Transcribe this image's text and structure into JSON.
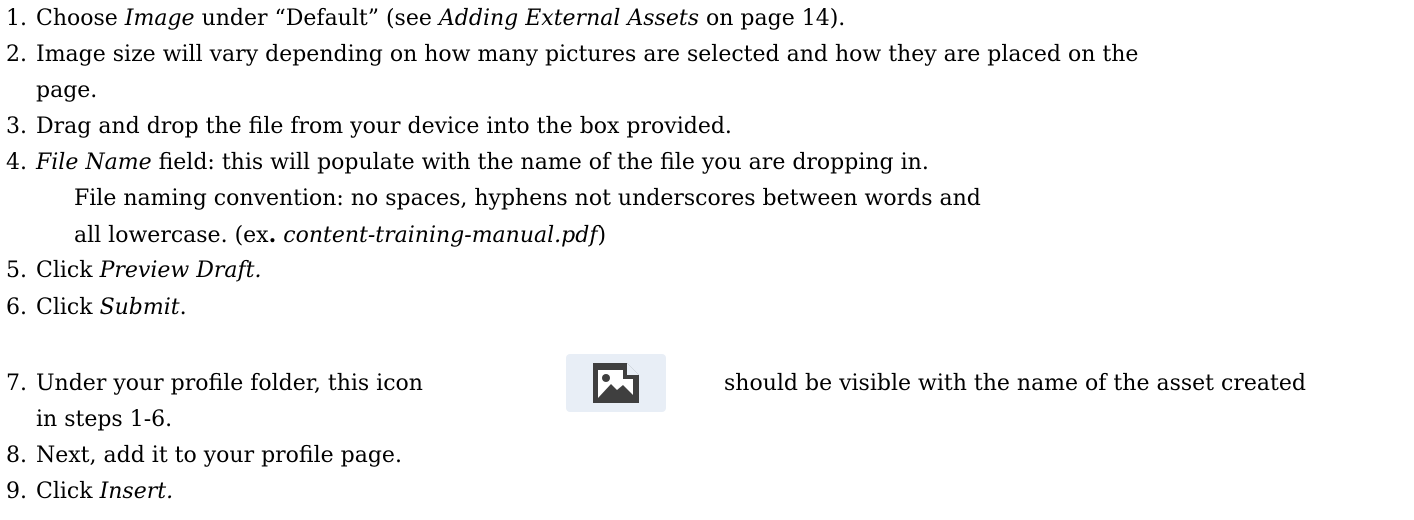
{
  "steps": [
    {
      "num": "1.",
      "parts": [
        {
          "t": "Choose ",
          "s": ""
        },
        {
          "t": "Image",
          "s": "i"
        },
        {
          "t": " under “Default” (see ",
          "s": ""
        },
        {
          "t": "Adding External Assets",
          "s": "i"
        },
        {
          "t": " on page 14).",
          "s": ""
        }
      ]
    },
    {
      "num": "2.",
      "parts": [
        {
          "t": "Image size will vary depending on how many pictures are selected and how they are placed on the",
          "s": ""
        }
      ]
    },
    {
      "cont": "page."
    },
    {
      "num": "3.",
      "parts": [
        {
          "t": "Drag and drop the file from your device into the box provided.",
          "s": ""
        }
      ]
    },
    {
      "num": "4.",
      "parts": [
        {
          "t": "File Name",
          "s": "i"
        },
        {
          "t": " field: this will populate with the name of the file you are dropping in.",
          "s": ""
        }
      ]
    },
    {
      "sub": "File naming convention: no spaces, hyphens not underscores between words and"
    },
    {
      "sub_parts": [
        {
          "t": "all lowercase. (ex",
          "s": ""
        },
        {
          "t": ".",
          "s": "b"
        },
        {
          "t": " ",
          "s": ""
        },
        {
          "t": "content-training-manual.pdf",
          "s": "i"
        },
        {
          "t": ")",
          "s": ""
        }
      ]
    },
    {
      "num": "5.",
      "parts": [
        {
          "t": "Click ",
          "s": ""
        },
        {
          "t": "Preview Draft.",
          "s": "i"
        }
      ]
    },
    {
      "num": "6.",
      "parts": [
        {
          "t": "Click ",
          "s": ""
        },
        {
          "t": "Submit",
          "s": "i"
        },
        {
          "t": ".",
          "s": ""
        }
      ]
    },
    {
      "num": "7.",
      "parts": [
        {
          "t": "Under your profile folder, this icon",
          "s": ""
        }
      ],
      "after_icon": "should be visible with the name of the asset created"
    },
    {
      "cont": "in steps 1-6."
    },
    {
      "num": "8.",
      "parts": [
        {
          "t": "Next, add it to your profile page.",
          "s": ""
        }
      ]
    },
    {
      "num": "9.",
      "parts": [
        {
          "t": "Click ",
          "s": ""
        },
        {
          "t": "Insert.",
          "s": "i"
        }
      ]
    }
  ],
  "icon": {
    "name": "image-asset-icon",
    "bg": "#e8eef6",
    "fg": "#3f3f3f"
  }
}
